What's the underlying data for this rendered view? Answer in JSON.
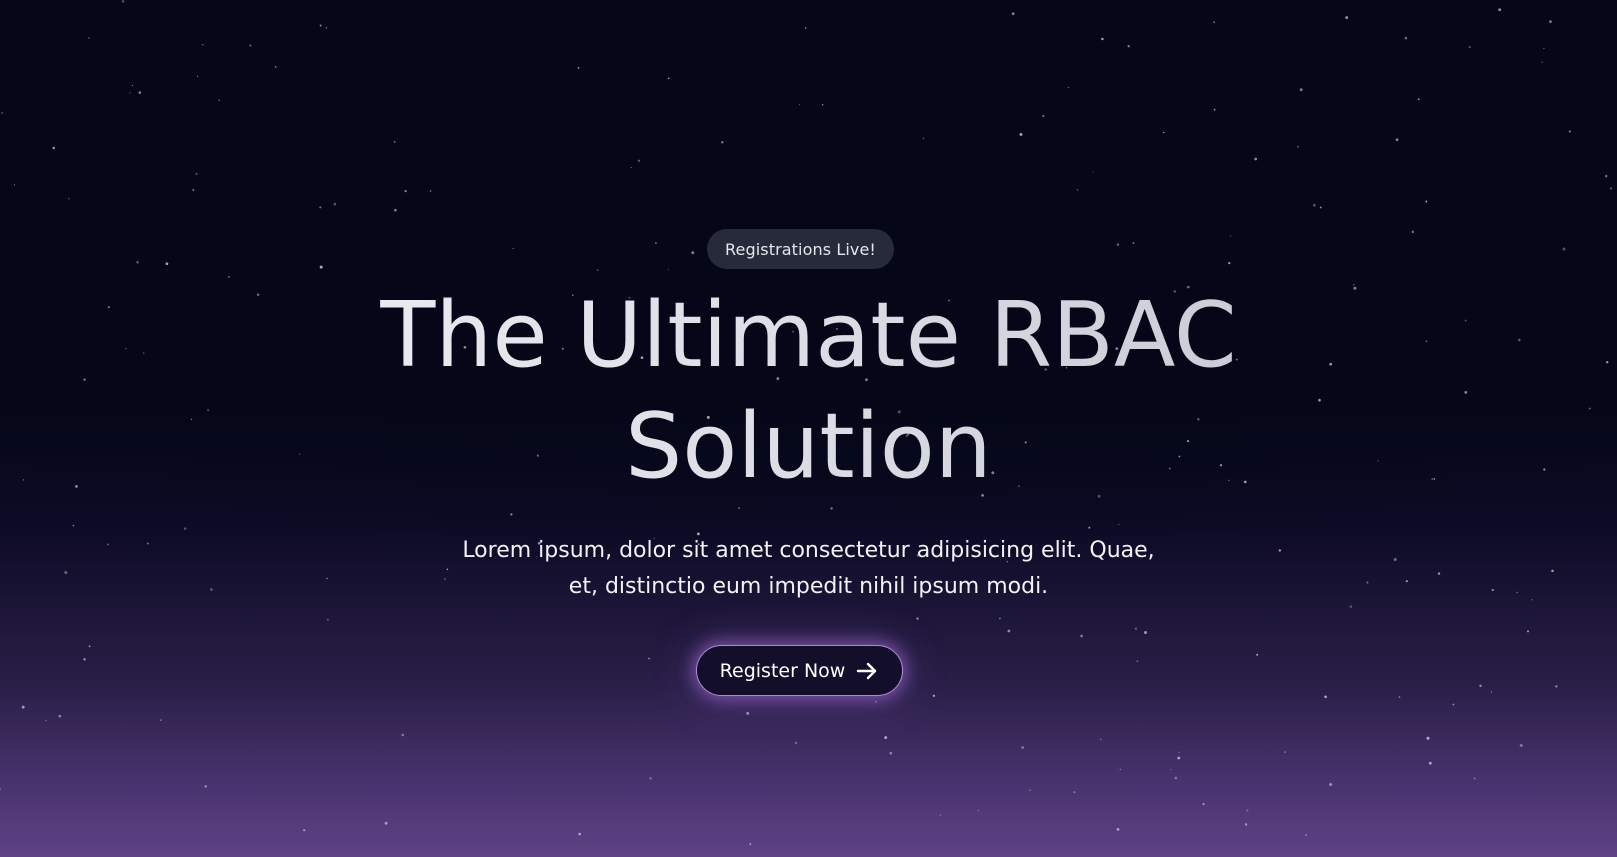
{
  "hero": {
    "badge_text": "Registrations Live!",
    "headline_line1": "The Ultimate RBAC",
    "headline_line2": "Solution",
    "subtitle_line1": "Lorem ipsum, dolor sit amet consectetur adipisicing elit. Quae,",
    "subtitle_line2": "et, distinctio eum impedit nihil ipsum modi.",
    "cta_label": "Register Now",
    "cta_icon": "arrow-right-icon"
  },
  "colors": {
    "background_top": "#050719",
    "background_bottom": "#5e4284",
    "badge_bg": "#262a3a",
    "cta_border": "#a98bd6",
    "cta_glow": "#b178e6"
  }
}
